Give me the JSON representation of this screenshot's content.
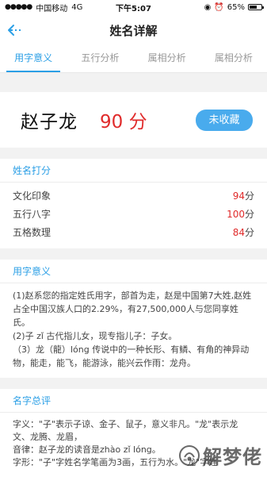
{
  "status_bar": {
    "carrier": "中国移动",
    "network": "4G",
    "time": "下午5:07",
    "battery": "65%",
    "battery_level": 0.65
  },
  "nav": {
    "title": "姓名详解"
  },
  "tabs": [
    {
      "label": "用字意义"
    },
    {
      "label": "五行分析"
    },
    {
      "label": "属相分析"
    },
    {
      "label": "属相分析"
    }
  ],
  "name_card": {
    "name": "赵子龙",
    "score": "90 分",
    "collect_label": "未收藏"
  },
  "rating": {
    "title": "姓名打分",
    "items": [
      {
        "label": "文化印象",
        "value": "94",
        "unit": "分"
      },
      {
        "label": "五行八字",
        "value": "100",
        "unit": "分"
      },
      {
        "label": "五格数理",
        "value": "84",
        "unit": "分"
      }
    ]
  },
  "meaning": {
    "title": "用字意义",
    "paragraphs": [
      "(1)赵系您的指定姓氏用字，部首为走，赵是中国第7大姓,赵姓占全中国汉族人口的2.29%，有27,500,000人与您同享姓氏。",
      "(2)子 zǐ 古代指儿女，现专指儿子：子女。",
      "（3）龙（龍）lóng 传说中的一种长形、有鳞、有角的神异动物，能走，能飞，能游泳，能兴云作雨：龙舟。"
    ]
  },
  "summary": {
    "title": "名字总评",
    "lines": [
      "字义：\"子\"表示子谅、金子、鼠子，意义非凡。\"龙\"表示龙文、龙腾、龙眉，",
      "音律：赵子龙的读音是zhào zǐ lóng。",
      "字形：\"子\"字姓名学笔画为3画，五行为水。\"龙\"字姓"
    ]
  },
  "watermark": {
    "text": "解梦佬"
  }
}
